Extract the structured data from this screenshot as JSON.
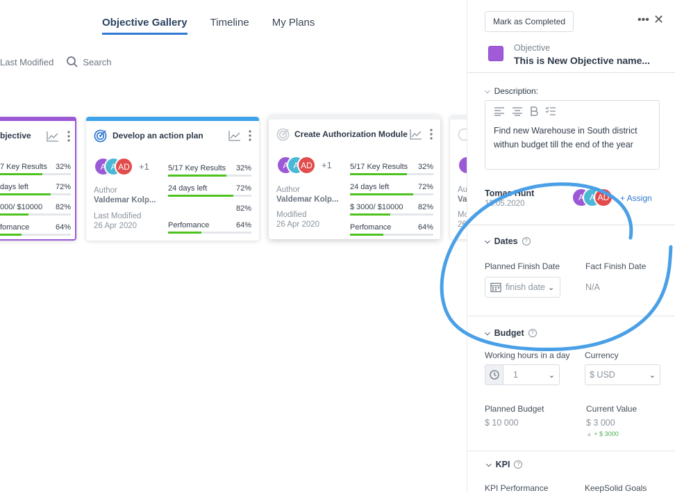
{
  "tabs": [
    {
      "label": "Objective Gallery",
      "active": true
    },
    {
      "label": "Timeline",
      "active": false
    },
    {
      "label": "My Plans",
      "active": false
    }
  ],
  "toolbar": {
    "sort_label": "Last Modified",
    "search_placeholder": "Search"
  },
  "cards": [
    {
      "title": "bjective",
      "accent": "#9b59d6",
      "key_results": "7 Key Results",
      "kr_pct": "32%",
      "kr_val": 0.32,
      "days_left": "days left",
      "days_pct": "72%",
      "days_val": 0.72,
      "budget": "000/ $10000",
      "budget_pct": "82%",
      "budget_val": 0.82,
      "perf": "fomance",
      "perf_pct": "64%",
      "perf_val": 0.64
    },
    {
      "title": "Develop an action plan",
      "accent": "#3fa3ec",
      "avatars": [
        "A",
        "A",
        "AD"
      ],
      "more": "+1",
      "author_label": "Author",
      "author": "Valdemar Kolp...",
      "modified_label": "Last Modified",
      "modified": "26 Apr 2020",
      "key_results": "5/17 Key Results",
      "kr_pct": "32%",
      "kr_val": 0.32,
      "days_left": "24 days left",
      "days_pct": "72%",
      "days_val": 0.72,
      "budget_pct": "82%",
      "perf": "Perfomance",
      "perf_pct": "64%",
      "perf_val": 0.64
    },
    {
      "title": "Create Authorization Module",
      "accent": "#cccccc",
      "avatars": [
        "A",
        "A",
        "AD"
      ],
      "more": "+1",
      "author_label": "Author",
      "author": "Valdemar Kolp...",
      "modified_label": "Modified",
      "modified": "26 Apr 2020",
      "key_results": "5/17 Key Results",
      "kr_pct": "32%",
      "kr_val": 0.32,
      "days_left": "24 days left",
      "days_pct": "72%",
      "days_val": 0.72,
      "budget": "$ 3000/ $10000",
      "budget_pct": "82%",
      "budget_val": 0.82,
      "perf": "Perfomance",
      "perf_pct": "64%",
      "perf_val": 0.64
    },
    {
      "author_label": "Au",
      "author": "Va",
      "modified_label": "Mo",
      "modified": "26"
    }
  ],
  "panel": {
    "mark_completed": "Mark as Completed",
    "more": "•••",
    "close": "✕",
    "obj_type": "Objective",
    "obj_name": "This is New Objective name...",
    "obj_color": "#a15bd9",
    "description_label": "Description:",
    "description_text": "Find new Warehouse in South district withun budget till the end of the year",
    "owner_name": "Tomas Hunt",
    "owner_date": "13.05.2020",
    "assign": "+ Assign",
    "dates_label": "Dates",
    "planned_finish_label": "Planned Finish Date",
    "planned_finish_value": "finish date",
    "fact_finish_label": "Fact Finish Date",
    "fact_finish_value": "N/A",
    "budget_label": "Budget",
    "working_hours_label": "Working hours in a day",
    "working_hours_value": "1",
    "currency_label": "Currency",
    "currency_value": "$ USD",
    "planned_budget_label": "Planned Budget",
    "planned_budget_value": "$ 10 000",
    "current_value_label": "Current Value",
    "current_value": "$ 3 000",
    "current_delta": "+ $ 3000",
    "kpi_label": "KPI",
    "kpi_perf_label": "KPI Performance",
    "keepsolid_label": "KeepSolid Goals"
  }
}
